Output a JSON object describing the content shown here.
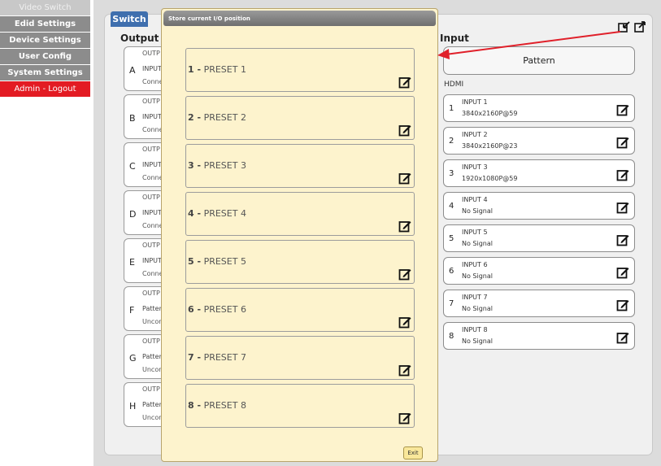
{
  "sidebar": {
    "items": [
      {
        "label": "Video Switch",
        "state": "dim"
      },
      {
        "label": "Edid Settings",
        "state": "normal"
      },
      {
        "label": "Device Settings",
        "state": "normal"
      },
      {
        "label": "User Config",
        "state": "normal"
      },
      {
        "label": "System Settings",
        "state": "normal"
      },
      {
        "label": "Admin - Logout",
        "state": "logout"
      }
    ]
  },
  "switch_tab": "Switch",
  "output_title": "Output",
  "input_title": "Input",
  "outputs": [
    {
      "letter": "A",
      "line1": "OUTP",
      "line2": "INPUT",
      "line3": "Conne"
    },
    {
      "letter": "B",
      "line1": "OUTP",
      "line2": "INPUT",
      "line3": "Conne"
    },
    {
      "letter": "C",
      "line1": "OUTP",
      "line2": "INPUT",
      "line3": "Conne"
    },
    {
      "letter": "D",
      "line1": "OUTP",
      "line2": "INPUT",
      "line3": "Conne"
    },
    {
      "letter": "E",
      "line1": "OUTP",
      "line2": "INPUT",
      "line3": "Conne"
    },
    {
      "letter": "F",
      "line1": "OUTP",
      "line2": "Patter",
      "line3": "Uncor"
    },
    {
      "letter": "G",
      "line1": "OUTP",
      "line2": "Patter",
      "line3": "Uncor"
    },
    {
      "letter": "H",
      "line1": "OUTP",
      "line2": "Patter",
      "line3": "Uncor"
    }
  ],
  "pattern_label": "Pattern",
  "hdmi_label": "HDMI",
  "inputs": [
    {
      "num": "1",
      "name": "INPUT 1",
      "res": "3840x2160P@59"
    },
    {
      "num": "2",
      "name": "INPUT 2",
      "res": "3840x2160P@23"
    },
    {
      "num": "3",
      "name": "INPUT 3",
      "res": "1920x1080P@59"
    },
    {
      "num": "4",
      "name": "INPUT 4",
      "res": "No Signal"
    },
    {
      "num": "5",
      "name": "INPUT 5",
      "res": "No Signal"
    },
    {
      "num": "6",
      "name": "INPUT 6",
      "res": "No Signal"
    },
    {
      "num": "7",
      "name": "INPUT 7",
      "res": "No Signal"
    },
    {
      "num": "8",
      "name": "INPUT 8",
      "res": "No Signal"
    }
  ],
  "modal": {
    "title": "Store current I/O position",
    "presets": [
      {
        "num": "1 -",
        "name": "PRESET 1"
      },
      {
        "num": "2 -",
        "name": "PRESET 2"
      },
      {
        "num": "3 -",
        "name": "PRESET 3"
      },
      {
        "num": "4 -",
        "name": "PRESET 4"
      },
      {
        "num": "5 -",
        "name": "PRESET 5"
      },
      {
        "num": "6 -",
        "name": "PRESET 6"
      },
      {
        "num": "7 -",
        "name": "PRESET 7"
      },
      {
        "num": "8 -",
        "name": "PRESET 8"
      }
    ],
    "exit_label": "Exit"
  },
  "icons": {
    "edit": "edit-icon",
    "store": "store-preset-icon",
    "load": "load-preset-icon"
  },
  "colors": {
    "accent_blue": "#3f6fae",
    "logout_red": "#e31b23",
    "modal_bg": "#fdf3cd",
    "arrow_red": "#e0202a"
  }
}
